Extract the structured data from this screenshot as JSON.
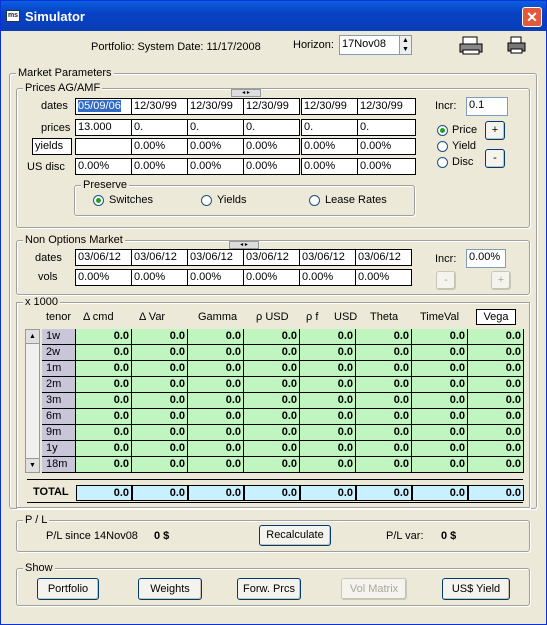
{
  "window": {
    "title": "Simulator",
    "icon_text": "ms"
  },
  "header": {
    "portfolio_label": "Portfolio: System Date: 11/17/2008",
    "horizon_label": "Horizon:",
    "horizon_value": "17Nov08"
  },
  "market": {
    "title": "Market Parameters",
    "prices_group": "Prices AG/AMF",
    "dates_label": "dates",
    "prices_label": "prices",
    "yields_label": "yields",
    "usdisc_label": "US disc",
    "dates": [
      "05/09/06",
      "12/30/99",
      "12/30/99",
      "12/30/99",
      "12/30/99",
      "12/30/99"
    ],
    "prices": [
      "13.000",
      "0.",
      "0.",
      "0.",
      "0.",
      "0."
    ],
    "yields": [
      "",
      "0.00%",
      "0.00%",
      "0.00%",
      "0.00%",
      "0.00%"
    ],
    "usdisc": [
      "0.00%",
      "0.00%",
      "0.00%",
      "0.00%",
      "0.00%",
      "0.00%"
    ],
    "incr_label": "Incr:",
    "incr_value": "0.1",
    "radio_price": "Price",
    "radio_yield": "Yield",
    "radio_disc": "Disc",
    "plus": "+",
    "minus": "-",
    "preserve": {
      "title": "Preserve",
      "switches": "Switches",
      "yields": "Yields",
      "lease": "Lease Rates"
    }
  },
  "nonopt": {
    "title": "Non Options Market",
    "dates_label": "dates",
    "vols_label": "vols",
    "dates": [
      "03/06/12",
      "03/06/12",
      "03/06/12",
      "03/06/12",
      "03/06/12",
      "03/06/12"
    ],
    "vols": [
      "0.00%",
      "0.00%",
      "0.00%",
      "0.00%",
      "0.00%",
      "0.00%"
    ],
    "incr_label": "Incr:",
    "incr_value": "0.00%",
    "minus": "-",
    "plus": "+"
  },
  "greeks": {
    "title": "x 1000",
    "headers": [
      "tenor",
      "Δ  cmd",
      "Δ  Var",
      "Gamma",
      "ρ  USD",
      "ρ  f",
      "USD",
      "Theta",
      "TimeVal",
      "Vega"
    ],
    "tenors": [
      "1w",
      "2w",
      "1m",
      "2m",
      "3m",
      "6m",
      "9m",
      "1y",
      "18m"
    ],
    "cell_value": "0.0",
    "total_label": "TOTAL",
    "total_value": "0.0"
  },
  "pl": {
    "title": "P / L",
    "since_label": "P/L since 14Nov08",
    "since_value": "0 $",
    "recalc": "Recalculate",
    "var_label": "P/L var:",
    "var_value": "0 $"
  },
  "show": {
    "title": "Show",
    "portfolio": "Portfolio",
    "weights": "Weights",
    "forw": "Forw. Prcs",
    "volmatrix": "Vol Matrix",
    "usyield": "US$ Yield"
  }
}
